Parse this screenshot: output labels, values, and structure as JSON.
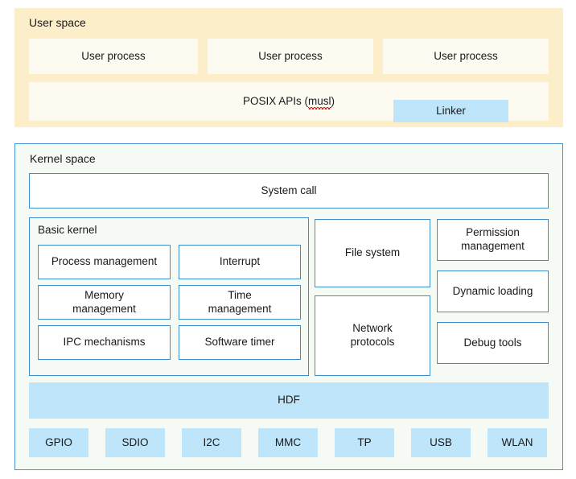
{
  "colors": {
    "user_space_bg": "#fdeeca",
    "user_box_bg": "#fdfaf1",
    "kernel_space_bg": "#f5faf4",
    "outline_blue": "#3d8ecc",
    "fill_blue": "#bfe5fa",
    "text": "#1a1a1a",
    "spellcheck_underline": "#e02020"
  },
  "user_space": {
    "title": "User space",
    "processes": [
      {
        "label": "User process"
      },
      {
        "label": "User process"
      },
      {
        "label": "User process"
      }
    ],
    "api_row": {
      "label_prefix": "POSIX APIs (",
      "label_misspelled": "musl",
      "label_suffix": ")",
      "linker": "Linker"
    }
  },
  "kernel_space": {
    "title": "Kernel space",
    "system_call": "System call",
    "basic_kernel": {
      "title": "Basic kernel",
      "modules": [
        {
          "label": "Process management"
        },
        {
          "label": "Interrupt"
        },
        {
          "label": "Memory\nmanagement"
        },
        {
          "label": "Time\nmanagement"
        },
        {
          "label": "IPC mechanisms"
        },
        {
          "label": "Software timer"
        }
      ]
    },
    "middle_column": [
      {
        "label": "File system"
      },
      {
        "label": "Network\nprotocols"
      }
    ],
    "right_column": [
      {
        "label": "Permission\nmanagement"
      },
      {
        "label": "Dynamic loading"
      },
      {
        "label": "Debug tools"
      }
    ],
    "hdf": "HDF",
    "drivers": [
      {
        "label": "GPIO"
      },
      {
        "label": "SDIO"
      },
      {
        "label": "I2C"
      },
      {
        "label": "MMC"
      },
      {
        "label": "TP"
      },
      {
        "label": "USB"
      },
      {
        "label": "WLAN"
      }
    ]
  }
}
